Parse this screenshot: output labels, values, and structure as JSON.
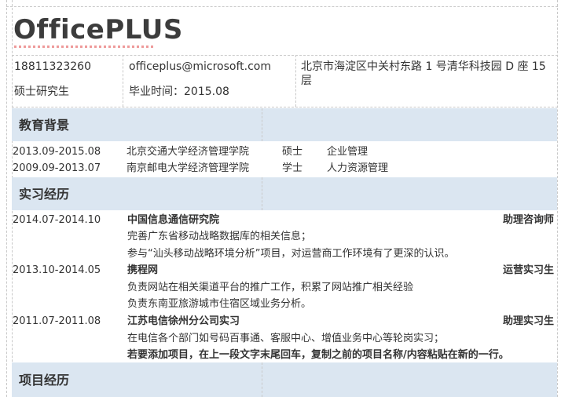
{
  "header": {
    "name": "OfficePLUS",
    "phone": "18811323260",
    "email": "officeplus@microsoft.com",
    "address": "北京市海淀区中关村东路 1 号清华科技园 D 座 15 层",
    "degree": "硕士研究生",
    "graduation": "毕业时间：2015.08"
  },
  "education": {
    "section_title": "教育背景",
    "rows": [
      {
        "period": "2013.09-2015.08",
        "school": "北京交通大学经济管理学院",
        "degree": "硕士",
        "major": "企业管理"
      },
      {
        "period": "2009.09-2013.07",
        "school": "南京邮电大学经济管理学院",
        "degree": "学士",
        "major": "人力资源管理"
      }
    ]
  },
  "internship": {
    "section_title": "实习经历",
    "entries": [
      {
        "period": "2014.07-2014.10",
        "company": "中国信息通信研究院",
        "role": "助理咨询师",
        "details": [
          "完善广东省移动战略数据库的相关信息；",
          "参与“汕头移动战略环境分析”项目，对运营商工作环境有了更深的认识。"
        ]
      },
      {
        "period": "2013.10-2014.05",
        "company": "携程网",
        "role": "运营实习生",
        "details": [
          "负责网站在相关渠道平台的推广工作，积累了网站推广相关经验",
          "负责东南亚旅游城市住宿区域业务分析。"
        ]
      },
      {
        "period": "2011.07-2011.08",
        "company": "江苏电信徐州分公司实习",
        "role": "助理实习生",
        "details": [
          "在电信各个部门如号码百事通、客服中心、增值业务中心等轮岗实习；"
        ],
        "tip": "若要添加项目，在上一段文字末尾回车，复制之前的项目名称/内容粘贴在新的一行。"
      }
    ]
  },
  "projects": {
    "section_title": "项目经历"
  }
}
